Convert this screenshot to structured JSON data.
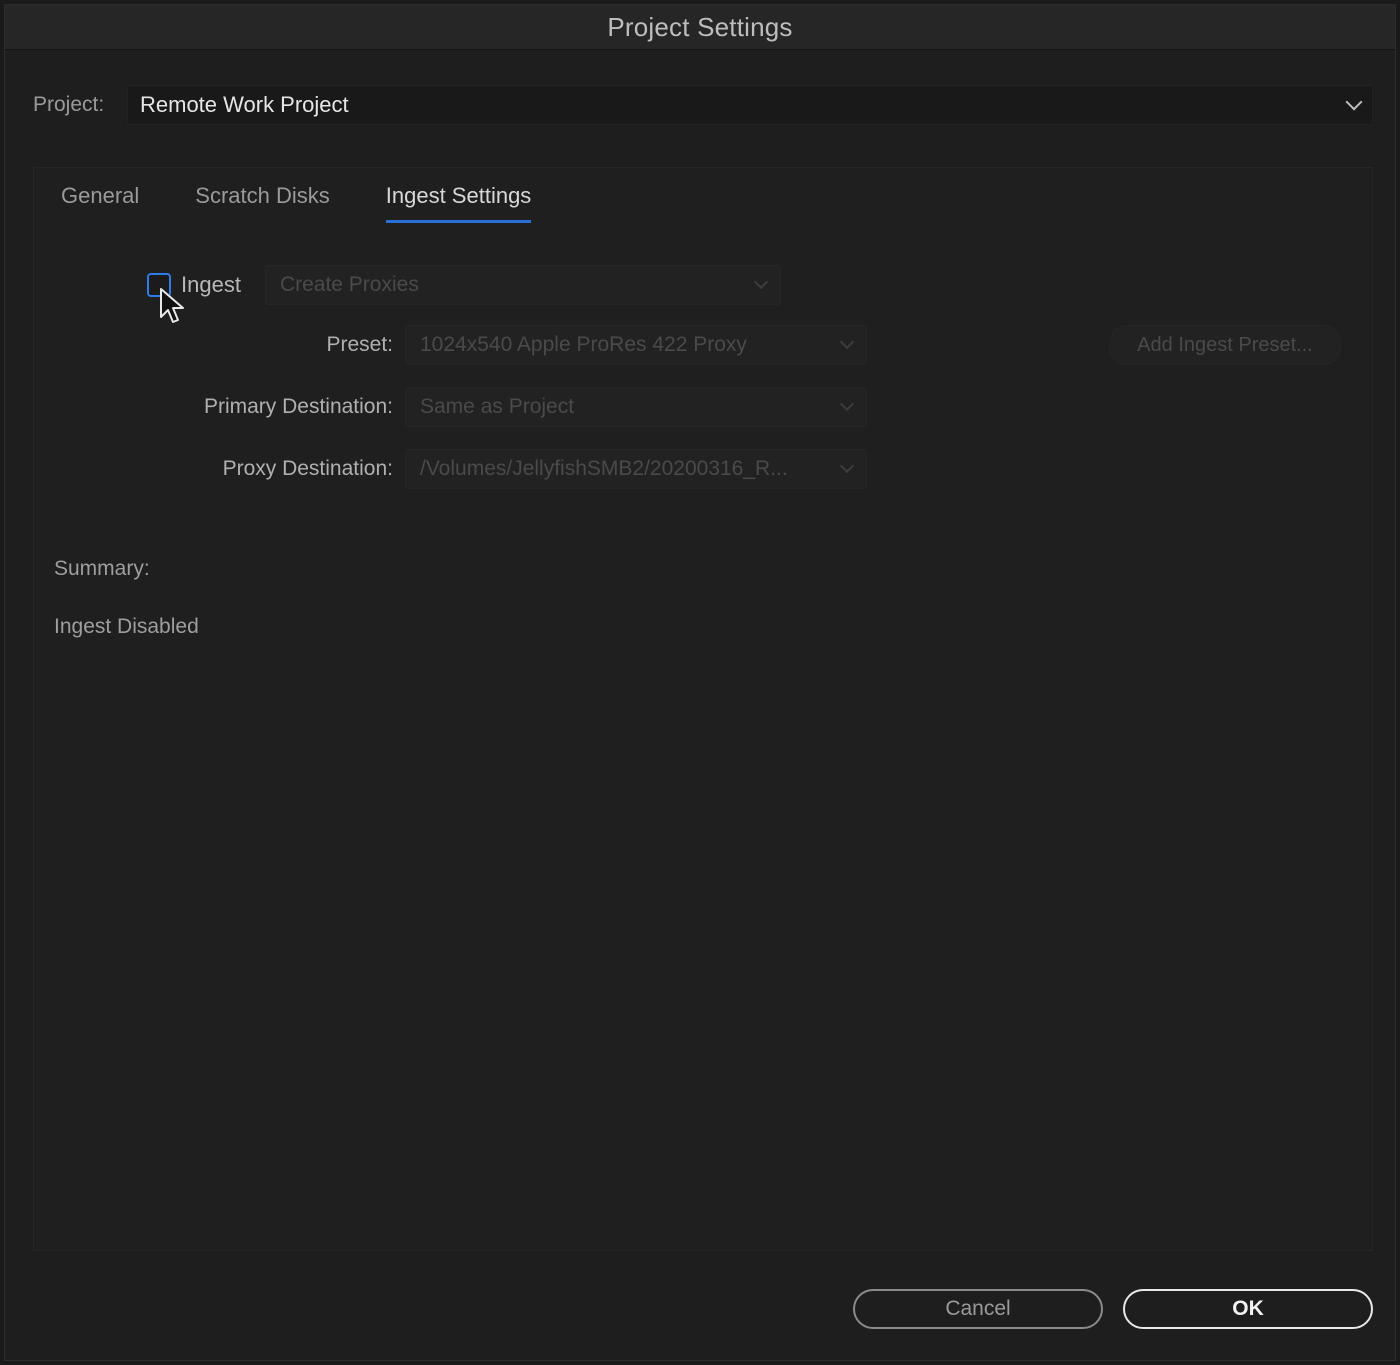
{
  "window": {
    "title": "Project Settings"
  },
  "project": {
    "label": "Project:",
    "value": "Remote Work Project"
  },
  "tabs": [
    {
      "label": "General",
      "active": false
    },
    {
      "label": "Scratch Disks",
      "active": false
    },
    {
      "label": "Ingest Settings",
      "active": true
    }
  ],
  "ingest": {
    "checkbox_label": "Ingest",
    "checked": false,
    "mode_value": "Create Proxies",
    "preset_label": "Preset:",
    "preset_value": "1024x540 Apple ProRes 422 Proxy",
    "add_preset_label": "Add Ingest Preset...",
    "primary_label": "Primary Destination:",
    "primary_value": "Same as Project",
    "proxy_label": "Proxy Destination:",
    "proxy_value": "/Volumes/JellyfishSMB2/20200316_R..."
  },
  "summary": {
    "label": "Summary:",
    "text": "Ingest Disabled"
  },
  "buttons": {
    "cancel": "Cancel",
    "ok": "OK"
  },
  "colors": {
    "accent": "#2a6fd6",
    "background": "#1e1e1e"
  }
}
